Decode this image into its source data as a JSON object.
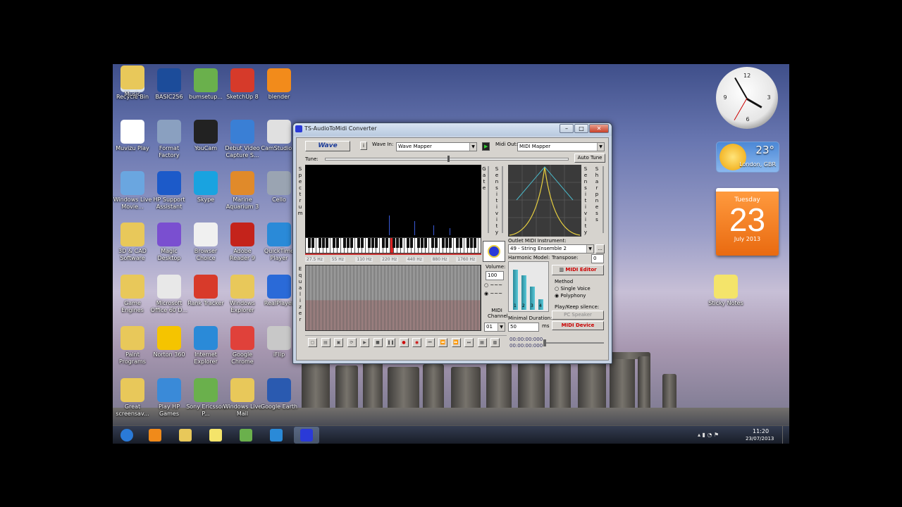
{
  "desktop": {
    "icons": [
      {
        "label": "Recycle Bin",
        "icon": "recycle-bin-icon",
        "color": "#d9e3ef"
      },
      {
        "label": "BASIC256",
        "icon": "basic256-icon",
        "color": "#1c4c9a"
      },
      {
        "label": "bumsetup...",
        "icon": "setup-icon",
        "color": "#6ab04c"
      },
      {
        "label": "SketchUp 8",
        "icon": "sketchup-icon",
        "color": "#d63a2a"
      },
      {
        "label": "blender",
        "icon": "blender-icon",
        "color": "#f28b1b"
      },
      {
        "label": "Muvizu Play",
        "icon": "muvizu-icon",
        "color": "#ffffff"
      },
      {
        "label": "Format Factory",
        "icon": "format-factory-icon",
        "color": "#8aa0c0"
      },
      {
        "label": "YouCam",
        "icon": "youcam-icon",
        "color": "#222222"
      },
      {
        "label": "Debut Video Capture S...",
        "icon": "debut-icon",
        "color": "#3a7fd5"
      },
      {
        "label": "CamStudio...",
        "icon": "camstudio-icon",
        "color": "#e0e0e0"
      },
      {
        "label": "Windows Live Movie...",
        "icon": "movie-maker-icon",
        "color": "#6aa6e0"
      },
      {
        "label": "HP Support Assistant",
        "icon": "help-icon",
        "color": "#1c5ac9"
      },
      {
        "label": "Skype",
        "icon": "skype-icon",
        "color": "#19a3e0"
      },
      {
        "label": "Marine Aquarium 3",
        "icon": "fish-icon",
        "color": "#e08a2a"
      },
      {
        "label": "Cello",
        "icon": "cello-icon",
        "color": "#9aa4b2"
      },
      {
        "label": "3D & CAD Software",
        "icon": "folder-icon",
        "color": "#e8c85a"
      },
      {
        "label": "Magic Desktop",
        "icon": "magic-desktop-icon",
        "color": "#7a4fd0"
      },
      {
        "label": "Browser Choice",
        "icon": "browser-choice-icon",
        "color": "#f0f0f0"
      },
      {
        "label": "Adobe Reader 9",
        "icon": "adobe-reader-icon",
        "color": "#c4231b"
      },
      {
        "label": "QuickTime Player",
        "icon": "quicktime-icon",
        "color": "#2a8ad8"
      },
      {
        "label": "Game Engines",
        "icon": "folder-icon",
        "color": "#e8c85a"
      },
      {
        "label": "Microsoft Office 60 D...",
        "icon": "office-icon",
        "color": "#e8e8e8"
      },
      {
        "label": "Rank Tracker",
        "icon": "rank-tracker-icon",
        "color": "#d83a2a"
      },
      {
        "label": "Windows Explorer",
        "icon": "explorer-icon",
        "color": "#e8c85a"
      },
      {
        "label": "RealPlayer",
        "icon": "realplayer-icon",
        "color": "#2a6ad8"
      },
      {
        "label": "Paint Programs",
        "icon": "folder-icon",
        "color": "#e8c85a"
      },
      {
        "label": "Norton 360",
        "icon": "norton-icon",
        "color": "#f5c400"
      },
      {
        "label": "Internet Explorer",
        "icon": "ie-icon",
        "color": "#2a8ad8"
      },
      {
        "label": "Google Chrome",
        "icon": "chrome-icon",
        "color": "#e0413a"
      },
      {
        "label": "iFlip",
        "icon": "iflip-icon",
        "color": "#c8c8c8"
      },
      {
        "label": "Great screensav...",
        "icon": "folder-icon",
        "color": "#e8c85a"
      },
      {
        "label": "Play HP Games",
        "icon": "hp-games-icon",
        "color": "#3a8ad8"
      },
      {
        "label": "Sony Ericsson P...",
        "icon": "phone-icon",
        "color": "#6ab04c"
      },
      {
        "label": "Windows Live Mail",
        "icon": "mail-icon",
        "color": "#e8c85a"
      },
      {
        "label": "Google Earth",
        "icon": "google-earth-icon",
        "color": "#2a5ab0"
      },
      {
        "label": "Music",
        "icon": "music-folder-icon",
        "color": "#e8c85a"
      },
      {
        "label": "Sticky Notes",
        "icon": "sticky-notes-icon",
        "color": "#f4e46a"
      }
    ]
  },
  "gadgets": {
    "weather": {
      "temp": "23°",
      "location": "London, GBR"
    },
    "calendar": {
      "weekday": "Tuesday",
      "date": "23",
      "month_year": "July 2013"
    }
  },
  "taskbar": {
    "time": "11:20",
    "date": "23/07/2013",
    "items": [
      {
        "name": "start-button",
        "color": "#2a7ad8"
      },
      {
        "name": "media-player-button",
        "color": "#f08a1a"
      },
      {
        "name": "explorer-button",
        "color": "#e8c85a"
      },
      {
        "name": "sticky-notes-button",
        "color": "#f4e46a"
      },
      {
        "name": "xbox-button",
        "color": "#6ab04c"
      },
      {
        "name": "ie-button",
        "color": "#2a8ad8"
      },
      {
        "name": "audiotomidi-button",
        "color": "#2a3ad8"
      }
    ]
  },
  "app": {
    "title": "TS-AudioToMidi Converter",
    "wave_button": "Wave",
    "wave_in_label": "Wave In:",
    "wave_in_value": "Wave Mapper",
    "midi_out_label": "Midi Out:",
    "midi_out_value": "MIDI Mapper",
    "tune_label": "Tune:",
    "auto_tune": "Auto Tune",
    "spectrum_label": [
      "S",
      "p",
      "e",
      "c",
      "t",
      "r",
      "u",
      "m"
    ],
    "gate_label": [
      "G",
      "a",
      "t",
      "e"
    ],
    "sensitivity_label": [
      "S",
      "e",
      "n",
      "s",
      "i",
      "t",
      "i",
      "v",
      "i",
      "t",
      "y"
    ],
    "sharpness_label": [
      "S",
      "h",
      "a",
      "r",
      "p",
      "n",
      "e",
      "s",
      "s"
    ],
    "equalizer_label": [
      "E",
      "q",
      "u",
      "a",
      "l",
      "i",
      "z",
      "e",
      "r"
    ],
    "freq_labels": [
      "27.5 Hz",
      "55 Hz",
      "110 Hz",
      "220 Hz",
      "440 Hz",
      "880 Hz",
      "1760 Hz"
    ],
    "outlet_label": "Outlet MIDI Instrument:",
    "instrument_value": "49 - String Ensemble 2",
    "browse": "...",
    "harmonic_label": "Harmonic Model:",
    "transpose_label": "Transpose:",
    "transpose_value": "0",
    "midi_editor": "MIDI Editor",
    "method_label": "Method",
    "single_voice": "Single Voice",
    "polyphony": "Polyphony",
    "volume_label": "Volume:",
    "volume_value": "100",
    "midi_channel_label": "MIDI Channel",
    "midi_channel_value": "01",
    "minimal_duration_label": "Minimal Duration:",
    "minimal_duration_value": "50",
    "ms": "ms",
    "play_keep_label": "Play/Keep silence:",
    "pc_speaker": "PC Speaker",
    "midi_device": "MIDI Device",
    "harmonic_bars": [
      {
        "label": "1",
        "level": 0.95
      },
      {
        "label": "2",
        "level": 0.82
      },
      {
        "label": "3",
        "level": 0.55
      },
      {
        "label": "4",
        "level": 0.25
      }
    ],
    "time1": "00:00:00:000",
    "time2": "00:00:00:000"
  }
}
